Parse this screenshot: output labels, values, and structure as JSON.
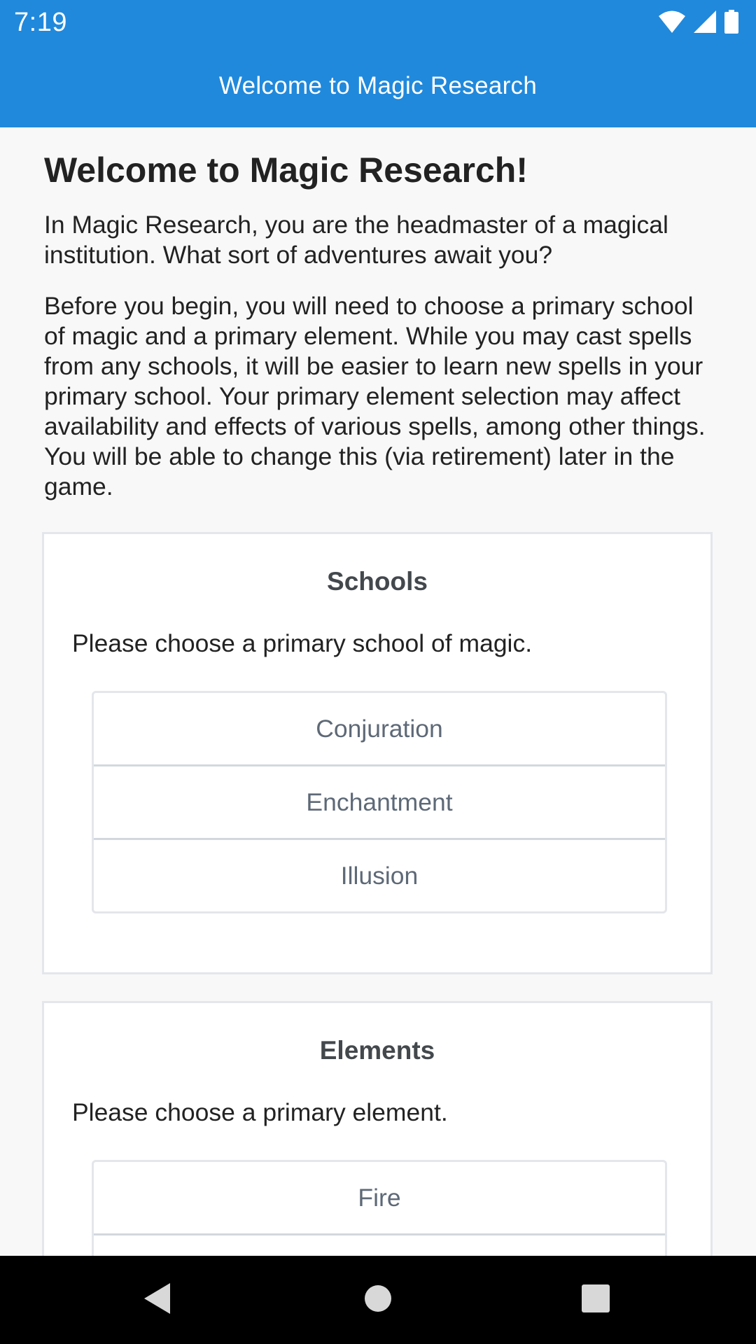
{
  "status_bar": {
    "time": "7:19",
    "icons": [
      "wifi-icon",
      "cell-signal-icon",
      "battery-icon"
    ]
  },
  "app_bar": {
    "title": "Welcome to Magic Research"
  },
  "main": {
    "heading": "Welcome to Magic Research!",
    "intro": "In Magic Research, you are the headmaster of a magical institution. What sort of adventures await you?",
    "details": "Before you begin, you will need to choose a primary school of magic and a primary element. While you may cast spells from any schools, it will be easier to learn new spells in your primary school. Your primary element selection may affect availability and effects of various spells, among other things. You will be able to change this (via retirement) later in the game."
  },
  "schools_card": {
    "title": "Schools",
    "description": "Please choose a primary school of magic.",
    "options": [
      "Conjuration",
      "Enchantment",
      "Illusion"
    ]
  },
  "elements_card": {
    "title": "Elements",
    "description": "Please choose a primary element.",
    "options": [
      "Fire"
    ]
  },
  "nav_bar": {
    "icons": [
      "back-icon",
      "home-icon",
      "recents-icon"
    ]
  },
  "colors": {
    "primary": "#2089dc",
    "card_border": "#e3e6ea",
    "option_text": "#5e6977",
    "nav_background": "#000000"
  }
}
